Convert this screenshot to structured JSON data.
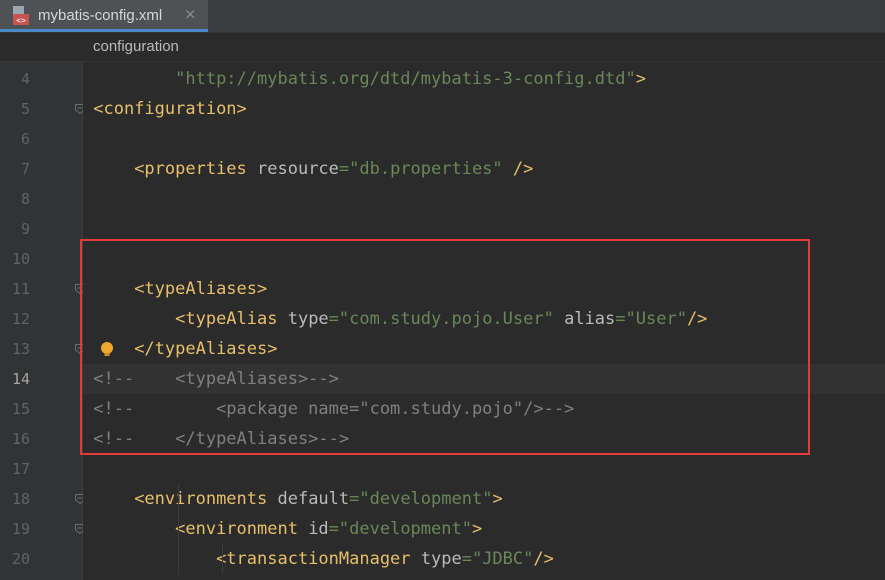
{
  "tab": {
    "title": "mybatis-config.xml",
    "close": "×",
    "icon": "xml-file-icon"
  },
  "breadcrumb": "configuration",
  "colors": {
    "tag": "#e8bf6a",
    "attribute": "#bababa",
    "string": "#6a8759",
    "comment": "#808080",
    "highlight": "#e03a3a"
  },
  "current_line": 14,
  "lines": [
    {
      "n": "4",
      "indent": "        ",
      "segs": [
        {
          "c": "str",
          "t": "\"http://mybatis.org/dtd/mybatis-3-config.dtd\""
        },
        {
          "c": "tag",
          "t": ">"
        }
      ]
    },
    {
      "n": "5",
      "indent": "",
      "segs": [
        {
          "c": "tag",
          "t": "<configuration>"
        }
      ]
    },
    {
      "n": "6",
      "indent": "",
      "segs": []
    },
    {
      "n": "7",
      "indent": "    ",
      "segs": [
        {
          "c": "tag",
          "t": "<properties "
        },
        {
          "c": "attr",
          "t": "resource"
        },
        {
          "c": "str",
          "t": "=\"db.properties\""
        },
        {
          "c": "tag",
          "t": " />"
        }
      ]
    },
    {
      "n": "8",
      "indent": "",
      "segs": []
    },
    {
      "n": "9",
      "indent": "",
      "segs": []
    },
    {
      "n": "10",
      "indent": "",
      "segs": []
    },
    {
      "n": "11",
      "indent": "    ",
      "segs": [
        {
          "c": "tag",
          "t": "<typeAliases>"
        }
      ]
    },
    {
      "n": "12",
      "indent": "        ",
      "segs": [
        {
          "c": "tag",
          "t": "<typeAlias "
        },
        {
          "c": "attr",
          "t": "type"
        },
        {
          "c": "str",
          "t": "=\"com.study.pojo.User\""
        },
        {
          "c": "tag",
          "t": " "
        },
        {
          "c": "attr",
          "t": "alias"
        },
        {
          "c": "str",
          "t": "=\"User\""
        },
        {
          "c": "tag",
          "t": "/>"
        }
      ]
    },
    {
      "n": "13",
      "indent": "    ",
      "segs": [
        {
          "c": "tag",
          "t": "</typeAliases>"
        }
      ]
    },
    {
      "n": "14",
      "indent": "",
      "segs": [
        {
          "c": "cmt",
          "t": "<!--    <typeAliases>-->"
        }
      ]
    },
    {
      "n": "15",
      "indent": "",
      "segs": [
        {
          "c": "cmt",
          "t": "<!--        <package name=\"com.study.pojo\"/>-->"
        }
      ]
    },
    {
      "n": "16",
      "indent": "",
      "segs": [
        {
          "c": "cmt",
          "t": "<!--    </typeAliases>-->"
        }
      ]
    },
    {
      "n": "17",
      "indent": "",
      "segs": []
    },
    {
      "n": "18",
      "indent": "    ",
      "segs": [
        {
          "c": "tag",
          "t": "<environments "
        },
        {
          "c": "attr",
          "t": "default"
        },
        {
          "c": "str",
          "t": "=\"development\""
        },
        {
          "c": "tag",
          "t": ">"
        }
      ]
    },
    {
      "n": "19",
      "indent": "        ",
      "segs": [
        {
          "c": "tag",
          "t": "<environment "
        },
        {
          "c": "attr",
          "t": "id"
        },
        {
          "c": "str",
          "t": "=\"development\""
        },
        {
          "c": "tag",
          "t": ">"
        }
      ]
    },
    {
      "n": "20",
      "indent": "            ",
      "segs": [
        {
          "c": "tag",
          "t": "<transactionManager "
        },
        {
          "c": "attr",
          "t": "type"
        },
        {
          "c": "str",
          "t": "=\"JDBC\""
        },
        {
          "c": "tag",
          "t": "/>"
        }
      ]
    }
  ],
  "fold_markers": [
    "5",
    "11",
    "13",
    "18",
    "19"
  ],
  "intention_bulb_line": "13"
}
